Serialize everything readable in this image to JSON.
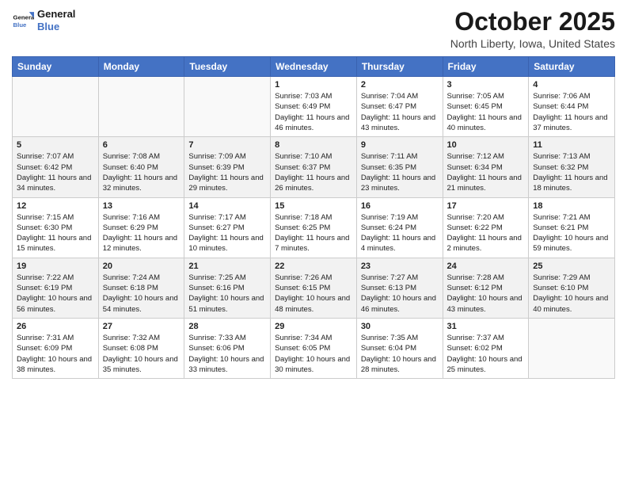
{
  "header": {
    "logo_line1": "General",
    "logo_line2": "Blue",
    "month": "October 2025",
    "location": "North Liberty, Iowa, United States"
  },
  "days_of_week": [
    "Sunday",
    "Monday",
    "Tuesday",
    "Wednesday",
    "Thursday",
    "Friday",
    "Saturday"
  ],
  "weeks": [
    [
      {
        "day": "",
        "sunrise": "",
        "sunset": "",
        "daylight": ""
      },
      {
        "day": "",
        "sunrise": "",
        "sunset": "",
        "daylight": ""
      },
      {
        "day": "",
        "sunrise": "",
        "sunset": "",
        "daylight": ""
      },
      {
        "day": "1",
        "sunrise": "Sunrise: 7:03 AM",
        "sunset": "Sunset: 6:49 PM",
        "daylight": "Daylight: 11 hours and 46 minutes."
      },
      {
        "day": "2",
        "sunrise": "Sunrise: 7:04 AM",
        "sunset": "Sunset: 6:47 PM",
        "daylight": "Daylight: 11 hours and 43 minutes."
      },
      {
        "day": "3",
        "sunrise": "Sunrise: 7:05 AM",
        "sunset": "Sunset: 6:45 PM",
        "daylight": "Daylight: 11 hours and 40 minutes."
      },
      {
        "day": "4",
        "sunrise": "Sunrise: 7:06 AM",
        "sunset": "Sunset: 6:44 PM",
        "daylight": "Daylight: 11 hours and 37 minutes."
      }
    ],
    [
      {
        "day": "5",
        "sunrise": "Sunrise: 7:07 AM",
        "sunset": "Sunset: 6:42 PM",
        "daylight": "Daylight: 11 hours and 34 minutes."
      },
      {
        "day": "6",
        "sunrise": "Sunrise: 7:08 AM",
        "sunset": "Sunset: 6:40 PM",
        "daylight": "Daylight: 11 hours and 32 minutes."
      },
      {
        "day": "7",
        "sunrise": "Sunrise: 7:09 AM",
        "sunset": "Sunset: 6:39 PM",
        "daylight": "Daylight: 11 hours and 29 minutes."
      },
      {
        "day": "8",
        "sunrise": "Sunrise: 7:10 AM",
        "sunset": "Sunset: 6:37 PM",
        "daylight": "Daylight: 11 hours and 26 minutes."
      },
      {
        "day": "9",
        "sunrise": "Sunrise: 7:11 AM",
        "sunset": "Sunset: 6:35 PM",
        "daylight": "Daylight: 11 hours and 23 minutes."
      },
      {
        "day": "10",
        "sunrise": "Sunrise: 7:12 AM",
        "sunset": "Sunset: 6:34 PM",
        "daylight": "Daylight: 11 hours and 21 minutes."
      },
      {
        "day": "11",
        "sunrise": "Sunrise: 7:13 AM",
        "sunset": "Sunset: 6:32 PM",
        "daylight": "Daylight: 11 hours and 18 minutes."
      }
    ],
    [
      {
        "day": "12",
        "sunrise": "Sunrise: 7:15 AM",
        "sunset": "Sunset: 6:30 PM",
        "daylight": "Daylight: 11 hours and 15 minutes."
      },
      {
        "day": "13",
        "sunrise": "Sunrise: 7:16 AM",
        "sunset": "Sunset: 6:29 PM",
        "daylight": "Daylight: 11 hours and 12 minutes."
      },
      {
        "day": "14",
        "sunrise": "Sunrise: 7:17 AM",
        "sunset": "Sunset: 6:27 PM",
        "daylight": "Daylight: 11 hours and 10 minutes."
      },
      {
        "day": "15",
        "sunrise": "Sunrise: 7:18 AM",
        "sunset": "Sunset: 6:25 PM",
        "daylight": "Daylight: 11 hours and 7 minutes."
      },
      {
        "day": "16",
        "sunrise": "Sunrise: 7:19 AM",
        "sunset": "Sunset: 6:24 PM",
        "daylight": "Daylight: 11 hours and 4 minutes."
      },
      {
        "day": "17",
        "sunrise": "Sunrise: 7:20 AM",
        "sunset": "Sunset: 6:22 PM",
        "daylight": "Daylight: 11 hours and 2 minutes."
      },
      {
        "day": "18",
        "sunrise": "Sunrise: 7:21 AM",
        "sunset": "Sunset: 6:21 PM",
        "daylight": "Daylight: 10 hours and 59 minutes."
      }
    ],
    [
      {
        "day": "19",
        "sunrise": "Sunrise: 7:22 AM",
        "sunset": "Sunset: 6:19 PM",
        "daylight": "Daylight: 10 hours and 56 minutes."
      },
      {
        "day": "20",
        "sunrise": "Sunrise: 7:24 AM",
        "sunset": "Sunset: 6:18 PM",
        "daylight": "Daylight: 10 hours and 54 minutes."
      },
      {
        "day": "21",
        "sunrise": "Sunrise: 7:25 AM",
        "sunset": "Sunset: 6:16 PM",
        "daylight": "Daylight: 10 hours and 51 minutes."
      },
      {
        "day": "22",
        "sunrise": "Sunrise: 7:26 AM",
        "sunset": "Sunset: 6:15 PM",
        "daylight": "Daylight: 10 hours and 48 minutes."
      },
      {
        "day": "23",
        "sunrise": "Sunrise: 7:27 AM",
        "sunset": "Sunset: 6:13 PM",
        "daylight": "Daylight: 10 hours and 46 minutes."
      },
      {
        "day": "24",
        "sunrise": "Sunrise: 7:28 AM",
        "sunset": "Sunset: 6:12 PM",
        "daylight": "Daylight: 10 hours and 43 minutes."
      },
      {
        "day": "25",
        "sunrise": "Sunrise: 7:29 AM",
        "sunset": "Sunset: 6:10 PM",
        "daylight": "Daylight: 10 hours and 40 minutes."
      }
    ],
    [
      {
        "day": "26",
        "sunrise": "Sunrise: 7:31 AM",
        "sunset": "Sunset: 6:09 PM",
        "daylight": "Daylight: 10 hours and 38 minutes."
      },
      {
        "day": "27",
        "sunrise": "Sunrise: 7:32 AM",
        "sunset": "Sunset: 6:08 PM",
        "daylight": "Daylight: 10 hours and 35 minutes."
      },
      {
        "day": "28",
        "sunrise": "Sunrise: 7:33 AM",
        "sunset": "Sunset: 6:06 PM",
        "daylight": "Daylight: 10 hours and 33 minutes."
      },
      {
        "day": "29",
        "sunrise": "Sunrise: 7:34 AM",
        "sunset": "Sunset: 6:05 PM",
        "daylight": "Daylight: 10 hours and 30 minutes."
      },
      {
        "day": "30",
        "sunrise": "Sunrise: 7:35 AM",
        "sunset": "Sunset: 6:04 PM",
        "daylight": "Daylight: 10 hours and 28 minutes."
      },
      {
        "day": "31",
        "sunrise": "Sunrise: 7:37 AM",
        "sunset": "Sunset: 6:02 PM",
        "daylight": "Daylight: 10 hours and 25 minutes."
      },
      {
        "day": "",
        "sunrise": "",
        "sunset": "",
        "daylight": ""
      }
    ]
  ]
}
